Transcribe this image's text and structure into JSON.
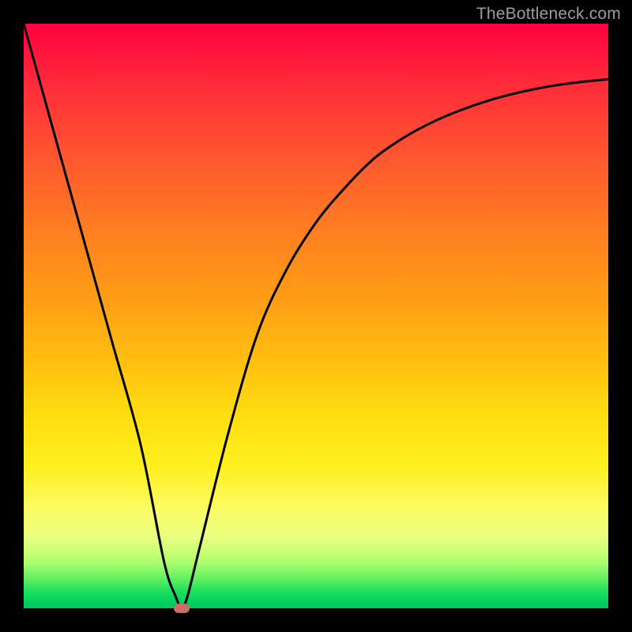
{
  "watermark": "TheBottleneck.com",
  "colors": {
    "frame": "#000000",
    "watermark": "#9c9c9c",
    "curve_stroke": "#000000",
    "dot": "#cc6e66",
    "gradient_top": "#ff0040",
    "gradient_bottom": "#00c860"
  },
  "chart_data": {
    "type": "line",
    "title": "",
    "xlabel": "",
    "ylabel": "",
    "xlim": [
      0,
      100
    ],
    "ylim": [
      0,
      100
    ],
    "annotations": [],
    "series": [
      {
        "name": "bottleneck-curve",
        "x": [
          0,
          5,
          10,
          15,
          20,
          24,
          26,
          27,
          28,
          30,
          35,
          40,
          45,
          50,
          55,
          60,
          65,
          70,
          75,
          80,
          85,
          90,
          95,
          100
        ],
        "values": [
          100,
          82,
          64,
          46,
          28,
          8,
          2,
          0,
          2,
          10,
          30,
          47,
          58,
          66,
          72,
          77,
          80.5,
          83.2,
          85.3,
          87,
          88.3,
          89.3,
          90,
          90.5
        ]
      }
    ],
    "marker": {
      "x": 27,
      "y": 0
    }
  }
}
